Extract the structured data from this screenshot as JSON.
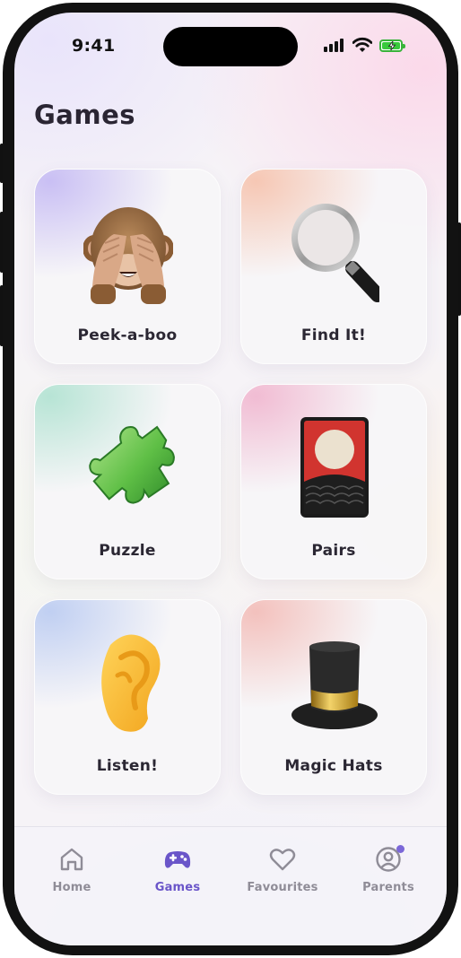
{
  "status": {
    "time": "9:41"
  },
  "page": {
    "title": "Games"
  },
  "games": [
    {
      "label": "Peek-a-boo",
      "icon": "see-no-evil-monkey-icon"
    },
    {
      "label": "Find It!",
      "icon": "magnifying-glass-icon"
    },
    {
      "label": "Puzzle",
      "icon": "puzzle-piece-icon"
    },
    {
      "label": "Pairs",
      "icon": "flower-playing-card-icon"
    },
    {
      "label": "Listen!",
      "icon": "ear-icon"
    },
    {
      "label": "Magic Hats",
      "icon": "top-hat-icon"
    }
  ],
  "tabs": [
    {
      "label": "Home",
      "icon": "home-icon",
      "active": false
    },
    {
      "label": "Games",
      "icon": "gamepad-icon",
      "active": true
    },
    {
      "label": "Favourites",
      "icon": "heart-icon",
      "active": false
    },
    {
      "label": "Parents",
      "icon": "user-circle-icon",
      "active": false,
      "badge": true
    }
  ],
  "colors": {
    "accent": "#6a55c9",
    "badge": "#7b67d8",
    "inactive_tab": "#8f8c97",
    "title": "#2a2533"
  }
}
